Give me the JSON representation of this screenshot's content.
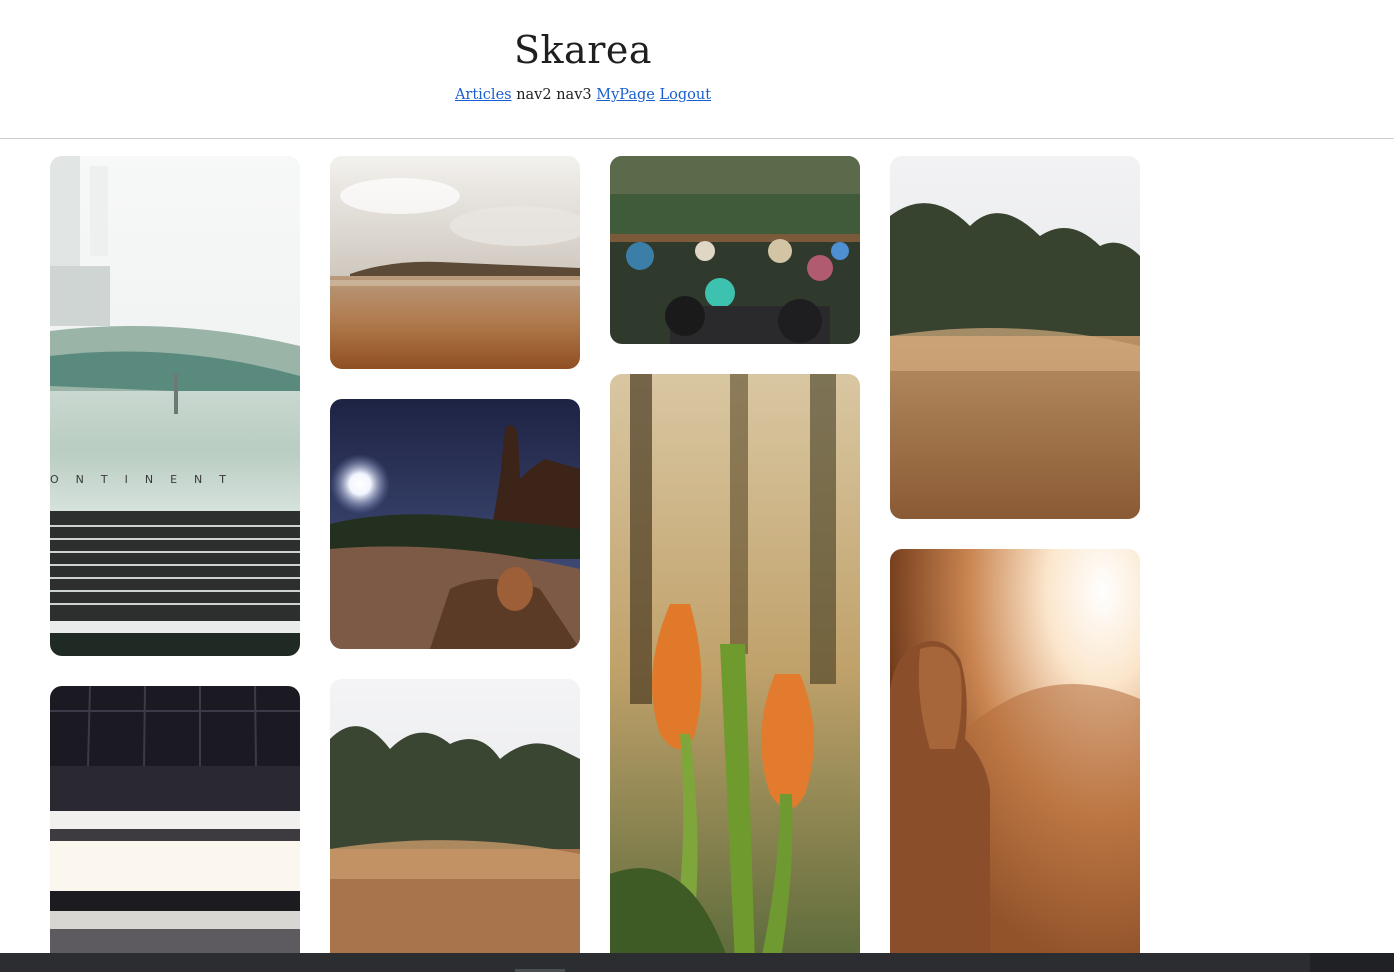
{
  "site": {
    "title": "Skarea",
    "nav": [
      {
        "label": "Articles",
        "link": true
      },
      {
        "label": "nav2",
        "link": false
      },
      {
        "label": "nav3",
        "link": false
      },
      {
        "label": "MyPage",
        "link": true
      },
      {
        "label": "Logout",
        "link": true
      }
    ]
  },
  "gallery": {
    "photos": [
      {
        "subject": "vintage Continental car grille",
        "grille_text": "ONTINENT"
      },
      {
        "subject": "monochrome blurred stripes interior"
      },
      {
        "subject": "sandy beach with clouds"
      },
      {
        "subject": "moonlit desert rock formation"
      },
      {
        "subject": "dry grass field with trees"
      },
      {
        "subject": "floating market boats from above"
      },
      {
        "subject": "orange tulips in sunlight"
      },
      {
        "subject": "dry grass field with trees"
      },
      {
        "subject": "woman silhouetted in sunset glow"
      }
    ]
  },
  "colors": {
    "link": "#1a5fd0",
    "divider": "#cfcfcf",
    "bottom_bar": "#2b2d30"
  }
}
